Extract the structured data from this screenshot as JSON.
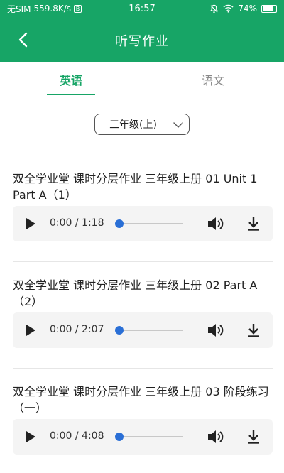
{
  "status_bar": {
    "carrier": "无SIM",
    "speed": "559.8K/s",
    "sim_badge": "B",
    "time": "16:57",
    "battery": "74%"
  },
  "header": {
    "title": "听写作业"
  },
  "tabs": [
    {
      "label": "英语",
      "active": true
    },
    {
      "label": "语文",
      "active": false
    }
  ],
  "grade": {
    "selected": "三年级(上)"
  },
  "items": [
    {
      "title": "双全学业堂 课时分层作业 三年级上册 01 Unit 1 Part A（1）",
      "time": "0:00 / 1:18",
      "progress": 0.0
    },
    {
      "title": "双全学业堂 课时分层作业 三年级上册 02 Part A（2）",
      "time": "0:00 / 2:07",
      "progress": 0.0
    },
    {
      "title": "双全学业堂 课时分层作业 三年级上册 03 阶段练习（一）",
      "time": "0:00 / 4:08",
      "progress": 0.0
    }
  ],
  "colors": {
    "brand": "#17a566",
    "thumb": "#2a6fd6"
  }
}
